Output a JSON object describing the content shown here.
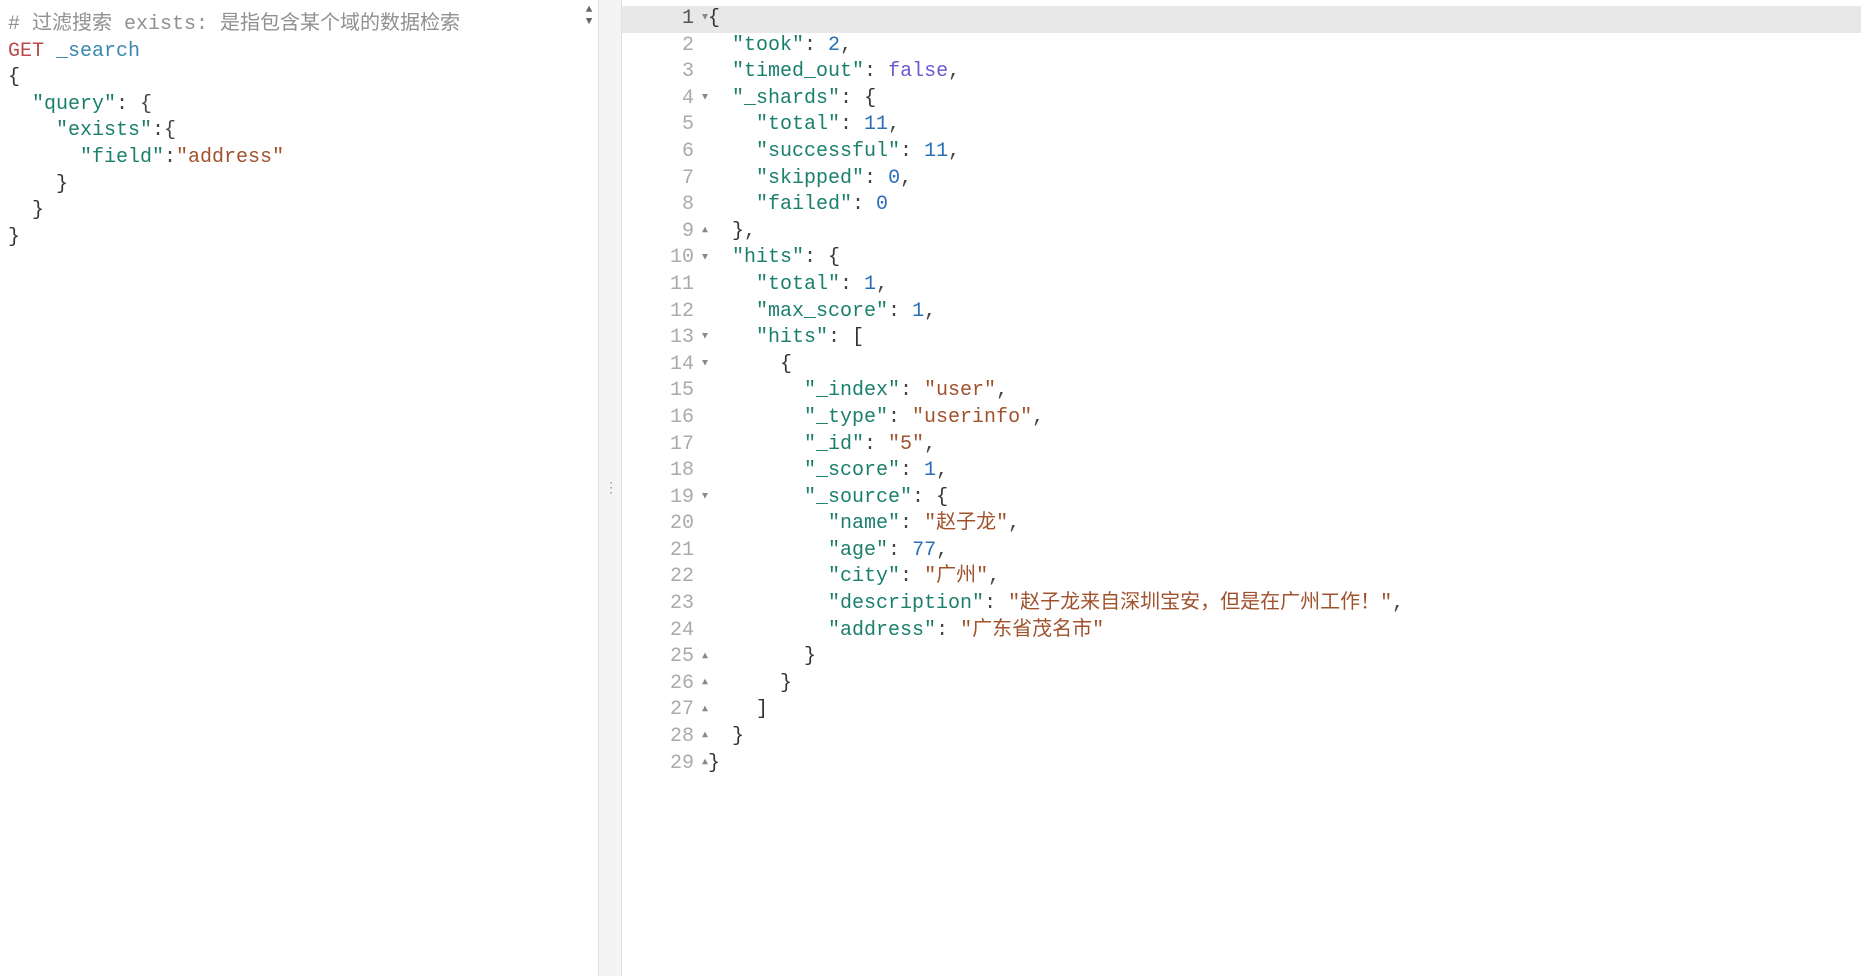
{
  "left": {
    "lines": [
      {
        "type": "comment",
        "text": "# 过滤搜索 exists: 是指包含某个域的数据检索"
      },
      {
        "type": "request",
        "method": "GET",
        "endpoint": "_search"
      },
      {
        "type": "brace",
        "text": "{"
      },
      {
        "type": "kv",
        "indent": 1,
        "key": "\"query\"",
        "after": ": {"
      },
      {
        "type": "kv",
        "indent": 2,
        "key": "\"exists\"",
        "after": ":{"
      },
      {
        "type": "kv",
        "indent": 3,
        "key": "\"field\"",
        "after": ":",
        "value": "\"address\""
      },
      {
        "type": "brace",
        "indent": 2,
        "text": "}"
      },
      {
        "type": "brace",
        "indent": 1,
        "text": "}"
      },
      {
        "type": "brace",
        "text": "}"
      }
    ]
  },
  "right": {
    "lines": [
      {
        "n": 1,
        "fold": "down",
        "active": true,
        "tokens": [
          {
            "t": "brace",
            "v": "{"
          }
        ]
      },
      {
        "n": 2,
        "tokens": [
          {
            "t": "ind",
            "v": 1
          },
          {
            "t": "key",
            "v": "\"took\""
          },
          {
            "t": "punc",
            "v": ": "
          },
          {
            "t": "num",
            "v": "2"
          },
          {
            "t": "punc",
            "v": ","
          }
        ]
      },
      {
        "n": 3,
        "tokens": [
          {
            "t": "ind",
            "v": 1
          },
          {
            "t": "key",
            "v": "\"timed_out\""
          },
          {
            "t": "punc",
            "v": ": "
          },
          {
            "t": "bool",
            "v": "false"
          },
          {
            "t": "punc",
            "v": ","
          }
        ]
      },
      {
        "n": 4,
        "fold": "down",
        "tokens": [
          {
            "t": "ind",
            "v": 1
          },
          {
            "t": "key",
            "v": "\"_shards\""
          },
          {
            "t": "punc",
            "v": ": "
          },
          {
            "t": "brace",
            "v": "{"
          }
        ]
      },
      {
        "n": 5,
        "tokens": [
          {
            "t": "ind",
            "v": 2
          },
          {
            "t": "key",
            "v": "\"total\""
          },
          {
            "t": "punc",
            "v": ": "
          },
          {
            "t": "num",
            "v": "11"
          },
          {
            "t": "punc",
            "v": ","
          }
        ]
      },
      {
        "n": 6,
        "tokens": [
          {
            "t": "ind",
            "v": 2
          },
          {
            "t": "key",
            "v": "\"successful\""
          },
          {
            "t": "punc",
            "v": ": "
          },
          {
            "t": "num",
            "v": "11"
          },
          {
            "t": "punc",
            "v": ","
          }
        ]
      },
      {
        "n": 7,
        "tokens": [
          {
            "t": "ind",
            "v": 2
          },
          {
            "t": "key",
            "v": "\"skipped\""
          },
          {
            "t": "punc",
            "v": ": "
          },
          {
            "t": "num",
            "v": "0"
          },
          {
            "t": "punc",
            "v": ","
          }
        ]
      },
      {
        "n": 8,
        "tokens": [
          {
            "t": "ind",
            "v": 2
          },
          {
            "t": "key",
            "v": "\"failed\""
          },
          {
            "t": "punc",
            "v": ": "
          },
          {
            "t": "num",
            "v": "0"
          }
        ]
      },
      {
        "n": 9,
        "fold": "up",
        "tokens": [
          {
            "t": "ind",
            "v": 1
          },
          {
            "t": "brace",
            "v": "}"
          },
          {
            "t": "punc",
            "v": ","
          }
        ]
      },
      {
        "n": 10,
        "fold": "down",
        "tokens": [
          {
            "t": "ind",
            "v": 1
          },
          {
            "t": "key",
            "v": "\"hits\""
          },
          {
            "t": "punc",
            "v": ": "
          },
          {
            "t": "brace",
            "v": "{"
          }
        ]
      },
      {
        "n": 11,
        "tokens": [
          {
            "t": "ind",
            "v": 2
          },
          {
            "t": "key",
            "v": "\"total\""
          },
          {
            "t": "punc",
            "v": ": "
          },
          {
            "t": "num",
            "v": "1"
          },
          {
            "t": "punc",
            "v": ","
          }
        ]
      },
      {
        "n": 12,
        "tokens": [
          {
            "t": "ind",
            "v": 2
          },
          {
            "t": "key",
            "v": "\"max_score\""
          },
          {
            "t": "punc",
            "v": ": "
          },
          {
            "t": "num",
            "v": "1"
          },
          {
            "t": "punc",
            "v": ","
          }
        ]
      },
      {
        "n": 13,
        "fold": "down",
        "tokens": [
          {
            "t": "ind",
            "v": 2
          },
          {
            "t": "key",
            "v": "\"hits\""
          },
          {
            "t": "punc",
            "v": ": "
          },
          {
            "t": "brace",
            "v": "["
          }
        ]
      },
      {
        "n": 14,
        "fold": "down",
        "tokens": [
          {
            "t": "ind",
            "v": 3
          },
          {
            "t": "brace",
            "v": "{"
          }
        ]
      },
      {
        "n": 15,
        "tokens": [
          {
            "t": "ind",
            "v": 4
          },
          {
            "t": "key",
            "v": "\"_index\""
          },
          {
            "t": "punc",
            "v": ": "
          },
          {
            "t": "str",
            "v": "\"user\""
          },
          {
            "t": "punc",
            "v": ","
          }
        ]
      },
      {
        "n": 16,
        "tokens": [
          {
            "t": "ind",
            "v": 4
          },
          {
            "t": "key",
            "v": "\"_type\""
          },
          {
            "t": "punc",
            "v": ": "
          },
          {
            "t": "str",
            "v": "\"userinfo\""
          },
          {
            "t": "punc",
            "v": ","
          }
        ]
      },
      {
        "n": 17,
        "tokens": [
          {
            "t": "ind",
            "v": 4
          },
          {
            "t": "key",
            "v": "\"_id\""
          },
          {
            "t": "punc",
            "v": ": "
          },
          {
            "t": "str",
            "v": "\"5\""
          },
          {
            "t": "punc",
            "v": ","
          }
        ]
      },
      {
        "n": 18,
        "tokens": [
          {
            "t": "ind",
            "v": 4
          },
          {
            "t": "key",
            "v": "\"_score\""
          },
          {
            "t": "punc",
            "v": ": "
          },
          {
            "t": "num",
            "v": "1"
          },
          {
            "t": "punc",
            "v": ","
          }
        ]
      },
      {
        "n": 19,
        "fold": "down",
        "tokens": [
          {
            "t": "ind",
            "v": 4
          },
          {
            "t": "key",
            "v": "\"_source\""
          },
          {
            "t": "punc",
            "v": ": "
          },
          {
            "t": "brace",
            "v": "{"
          }
        ]
      },
      {
        "n": 20,
        "tokens": [
          {
            "t": "ind",
            "v": 5
          },
          {
            "t": "key",
            "v": "\"name\""
          },
          {
            "t": "punc",
            "v": ": "
          },
          {
            "t": "str",
            "v": "\"赵子龙\""
          },
          {
            "t": "punc",
            "v": ","
          }
        ]
      },
      {
        "n": 21,
        "tokens": [
          {
            "t": "ind",
            "v": 5
          },
          {
            "t": "key",
            "v": "\"age\""
          },
          {
            "t": "punc",
            "v": ": "
          },
          {
            "t": "num",
            "v": "77"
          },
          {
            "t": "punc",
            "v": ","
          }
        ]
      },
      {
        "n": 22,
        "tokens": [
          {
            "t": "ind",
            "v": 5
          },
          {
            "t": "key",
            "v": "\"city\""
          },
          {
            "t": "punc",
            "v": ": "
          },
          {
            "t": "str",
            "v": "\"广州\""
          },
          {
            "t": "punc",
            "v": ","
          }
        ]
      },
      {
        "n": 23,
        "tokens": [
          {
            "t": "ind",
            "v": 5
          },
          {
            "t": "key",
            "v": "\"description\""
          },
          {
            "t": "punc",
            "v": ": "
          },
          {
            "t": "str",
            "v": "\"赵子龙来自深圳宝安，但是在广州工作！\""
          },
          {
            "t": "punc",
            "v": ","
          }
        ]
      },
      {
        "n": 24,
        "tokens": [
          {
            "t": "ind",
            "v": 5
          },
          {
            "t": "key",
            "v": "\"address\""
          },
          {
            "t": "punc",
            "v": ": "
          },
          {
            "t": "str",
            "v": "\"广东省茂名市\""
          }
        ]
      },
      {
        "n": 25,
        "fold": "up",
        "tokens": [
          {
            "t": "ind",
            "v": 4
          },
          {
            "t": "brace",
            "v": "}"
          }
        ]
      },
      {
        "n": 26,
        "fold": "up",
        "tokens": [
          {
            "t": "ind",
            "v": 3
          },
          {
            "t": "brace",
            "v": "}"
          }
        ]
      },
      {
        "n": 27,
        "fold": "up",
        "tokens": [
          {
            "t": "ind",
            "v": 2
          },
          {
            "t": "brace",
            "v": "]"
          }
        ]
      },
      {
        "n": 28,
        "fold": "up",
        "tokens": [
          {
            "t": "ind",
            "v": 1
          },
          {
            "t": "brace",
            "v": "}"
          }
        ]
      },
      {
        "n": 29,
        "fold": "up",
        "tokens": [
          {
            "t": "brace",
            "v": "}"
          }
        ]
      }
    ]
  },
  "drag_dots": "⋮"
}
